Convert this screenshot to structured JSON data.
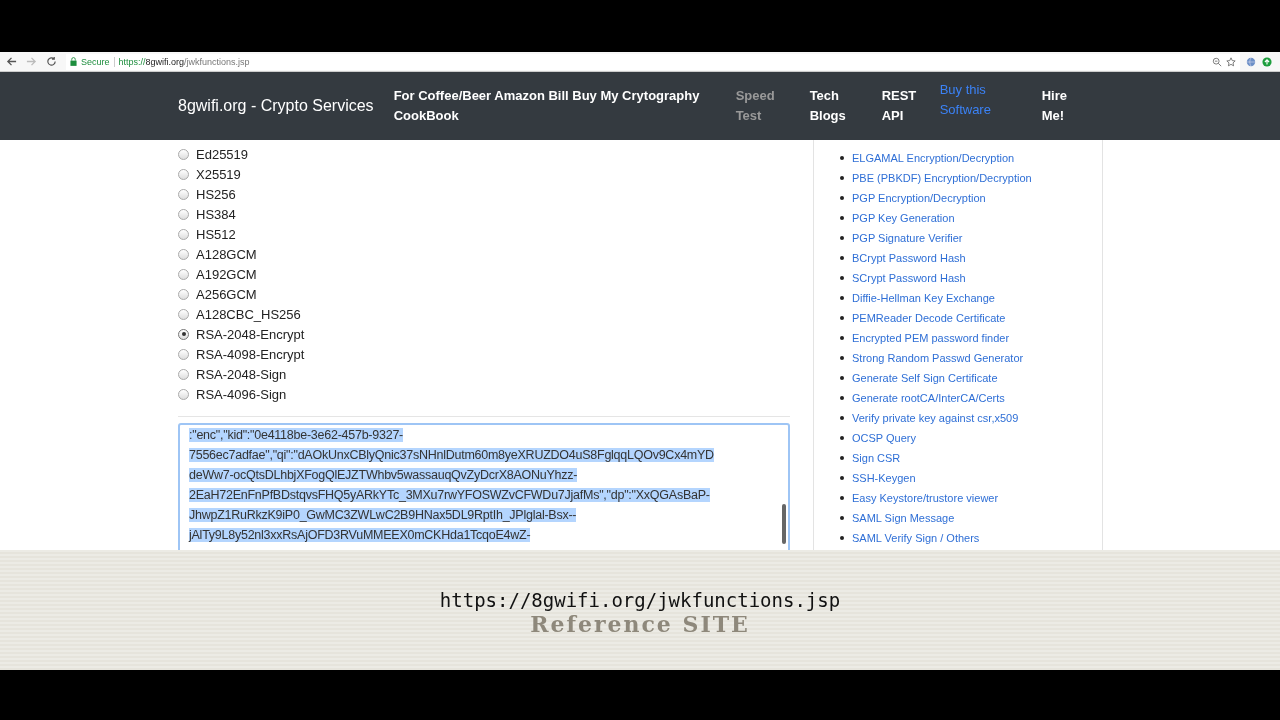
{
  "browser": {
    "secure_label": "Secure",
    "url_scheme": "https://",
    "url_host": "8gwifi.org",
    "url_path": "/jwkfunctions.jsp"
  },
  "navbar": {
    "brand": "8gwifi.org - Crypto Services",
    "items": [
      {
        "label": "For Coffee/Beer Amazon Bill Buy My Crytography CookBook",
        "kind": "normal"
      },
      {
        "label": "Speed Test",
        "kind": "muted"
      },
      {
        "label": "Tech Blogs",
        "kind": "normal"
      },
      {
        "label": "REST API",
        "kind": "normal"
      },
      {
        "label": "Buy this Software",
        "kind": "highlight"
      },
      {
        "label": "Hire Me!",
        "kind": "normal"
      }
    ]
  },
  "algorithms": [
    {
      "label": "Ed25519",
      "selected": false
    },
    {
      "label": "X25519",
      "selected": false
    },
    {
      "label": "HS256",
      "selected": false
    },
    {
      "label": "HS384",
      "selected": false
    },
    {
      "label": "HS512",
      "selected": false
    },
    {
      "label": "A128GCM",
      "selected": false
    },
    {
      "label": "A192GCM",
      "selected": false
    },
    {
      "label": "A256GCM",
      "selected": false
    },
    {
      "label": "A128CBC_HS256",
      "selected": false
    },
    {
      "label": "RSA-2048-Encrypt",
      "selected": true
    },
    {
      "label": "RSA-4098-Encrypt",
      "selected": false
    },
    {
      "label": "RSA-2048-Sign",
      "selected": false
    },
    {
      "label": "RSA-4096-Sign",
      "selected": false
    }
  ],
  "key_output": {
    "lines": [
      ":\"enc\",\"kid\":\"0e4118be-3e62-457b-9327-",
      "7556ec7adfae\",\"qi\":\"dAOkUnxCBlyQnic37sNHnlDutm60m8yeXRUZDO4uS8FglqqLQOv9Cx4mYD",
      "deWw7-ocQtsDLhbjXFogQlEJZTWhbv5wassauqQvZyDcrX8AONuYhzz-",
      "2EaH72EnFnPfBDstqvsFHQ5yARkYTc_3MXu7rwYFOSWZvCFWDu7JjafMs\",\"dp\":\"XxQGAsBaP-",
      "JhwpZ1RuRkzK9iP0_GwMC3ZWLwC2B9HNax5DL9RptIh_JPlglal-Bsx--",
      "jAlTy9L8y52nl3xxRsAjOFD3RVuMMEEX0mCKHda1TcqoE4wZ-"
    ]
  },
  "sidebar": {
    "links": [
      "ELGAMAL Encryption/Decryption",
      "PBE (PBKDF) Encryption/Decryption",
      "PGP Encryption/Decryption",
      "PGP Key Generation",
      "PGP Signature Verifier",
      "BCrypt Password Hash",
      "SCrypt Password Hash",
      "Diffie-Hellman Key Exchange",
      "PEMReader Decode Certificate",
      "Encrypted PEM password finder",
      "Strong Random Passwd Generator",
      "Generate Self Sign Certificate",
      "Generate rootCA/InterCA/Certs",
      "Verify private key against csr,x509",
      "OCSP Query",
      "Sign CSR",
      "SSH-Keygen",
      "Easy Keystore/trustore viewer",
      "SAML Sign Message",
      "SAML Verify Sign / Others"
    ]
  },
  "caption": {
    "url": "https://8gwifi.org/jwkfunctions.jsp",
    "subtitle": "Reference SITE"
  }
}
